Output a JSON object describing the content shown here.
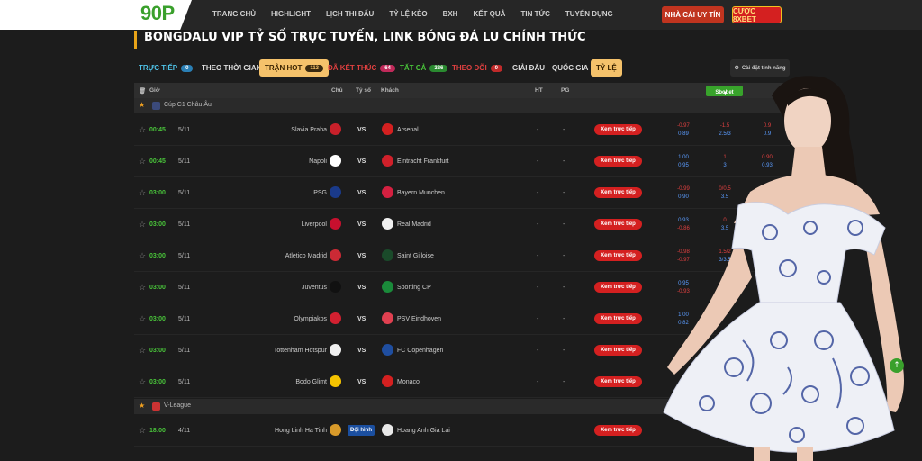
{
  "logo": "90P",
  "nav": [
    "TRANG CHỦ",
    "HIGHLIGHT",
    "LỊCH THI ĐẤU",
    "TỶ LỆ KÈO",
    "BXH",
    "KẾT QUẢ",
    "TIN TỨC",
    "TUYỂN DỤNG"
  ],
  "buttons": {
    "trusted": "NHÀ CÁI UY TÍN",
    "bet": "CƯỢC 8XBET"
  },
  "headline": "BONGDALU VIP TỶ SỐ TRỰC TUYẾN, LINK BÓNG ĐÁ LU CHÍNH THỨC",
  "tabs": [
    {
      "label": "TRỰC TIẾP",
      "badge": "0"
    },
    {
      "label": "THEO THỜI GIAN"
    },
    {
      "label": "TRẬN HOT",
      "badge": "113"
    },
    {
      "label": "ĐÃ KẾT THÚC",
      "badge": "64"
    },
    {
      "label": "TẤT CẢ",
      "badge": "326"
    },
    {
      "label": "THEO DÕI",
      "badge": "0"
    },
    {
      "label": "GIẢI ĐẤU"
    },
    {
      "label": "QUỐC GIA"
    },
    {
      "label": "TỶ LỆ"
    }
  ],
  "settings_label": "Cài đặt tính năng",
  "table_header": {
    "time": "Giờ",
    "home": "Chủ",
    "score": "Tỷ số",
    "away": "Khách",
    "ht": "HT",
    "pg": "PG",
    "bookmaker": "Sbobet"
  },
  "leagues": [
    {
      "name": "Cúp C1 Châu Âu"
    },
    {
      "name": "V-League"
    }
  ],
  "matches": [
    {
      "time": "00:45",
      "date": "5/11",
      "home": "Slavia Praha",
      "away": "Arsenal",
      "ht": "-",
      "pg": "-",
      "live": "Xem trực tiếp",
      "o1": [
        "-0.97",
        "0.89"
      ],
      "o2": [
        "-1.5",
        "2.5/3"
      ],
      "o3": [
        "0.9",
        "0.9"
      ]
    },
    {
      "time": "00:45",
      "date": "5/11",
      "home": "Napoli",
      "away": "Eintracht Frankfurt",
      "ht": "-",
      "pg": "-",
      "live": "Xem trực tiếp",
      "o1": [
        "1.00",
        "0.95"
      ],
      "o2": [
        "1",
        "3"
      ],
      "o3": [
        "0.90",
        "0.93"
      ]
    },
    {
      "time": "03:00",
      "date": "5/11",
      "home": "PSG",
      "away": "Bayern Munchen",
      "ht": "-",
      "pg": "-",
      "live": "Xem trực tiếp",
      "o1": [
        "-0.99",
        "0.90"
      ],
      "o2": [
        "0/0.5",
        "3.5"
      ],
      "o3": [
        "",
        ""
      ]
    },
    {
      "time": "03:00",
      "date": "5/11",
      "home": "Liverpool",
      "away": "Real Madrid",
      "ht": "-",
      "pg": "-",
      "live": "Xem trực tiếp",
      "o1": [
        "0.93",
        "-0.86"
      ],
      "o2": [
        "0",
        "3.5"
      ],
      "o3": [
        "",
        ""
      ]
    },
    {
      "time": "03:00",
      "date": "5/11",
      "home": "Atletico Madrid",
      "away": "Saint Gilloise",
      "ht": "-",
      "pg": "-",
      "live": "Xem trực tiếp",
      "o1": [
        "-0.98",
        "-0.97"
      ],
      "o2": [
        "1.5/2",
        "3/3.5"
      ],
      "o3": [
        "",
        ""
      ]
    },
    {
      "time": "03:00",
      "date": "5/11",
      "home": "Juventus",
      "away": "Sporting CP",
      "ht": "-",
      "pg": "-",
      "live": "Xem trực tiếp",
      "o1": [
        "0.95",
        "-0.93"
      ],
      "o2": [
        "",
        ""
      ],
      "o3": [
        "",
        ""
      ]
    },
    {
      "time": "03:00",
      "date": "5/11",
      "home": "Olympiakos",
      "away": "PSV Eindhoven",
      "ht": "-",
      "pg": "-",
      "live": "Xem trực tiếp",
      "o1": [
        "1.00",
        "0.82"
      ],
      "o2": [
        "",
        ""
      ],
      "o3": [
        "",
        ""
      ]
    },
    {
      "time": "03:00",
      "date": "5/11",
      "home": "Tottenham Hotspur",
      "away": "FC Copenhagen",
      "ht": "-",
      "pg": "-",
      "live": "Xem trực tiếp",
      "o1": [
        "",
        ""
      ],
      "o2": [
        "",
        ""
      ],
      "o3": [
        "",
        ""
      ]
    },
    {
      "time": "03:00",
      "date": "5/11",
      "home": "Bodo Glimt",
      "away": "Monaco",
      "ht": "-",
      "pg": "-",
      "live": "Xem trực tiếp",
      "o1": [
        "",
        ""
      ],
      "o2": [
        "",
        ""
      ],
      "o3": [
        "",
        ""
      ]
    }
  ],
  "vleague_match": {
    "time": "18:00",
    "date": "4/11",
    "home": "Hong Linh Ha Tinh",
    "tag": "Đội hình",
    "away": "Hoang Anh Gia Lai",
    "live": "Xem trực tiếp"
  },
  "colors": {
    "accent": "#3aa02c",
    "live": "#d42020",
    "tab_active": "#f5c26b",
    "time": "#49c43a"
  }
}
